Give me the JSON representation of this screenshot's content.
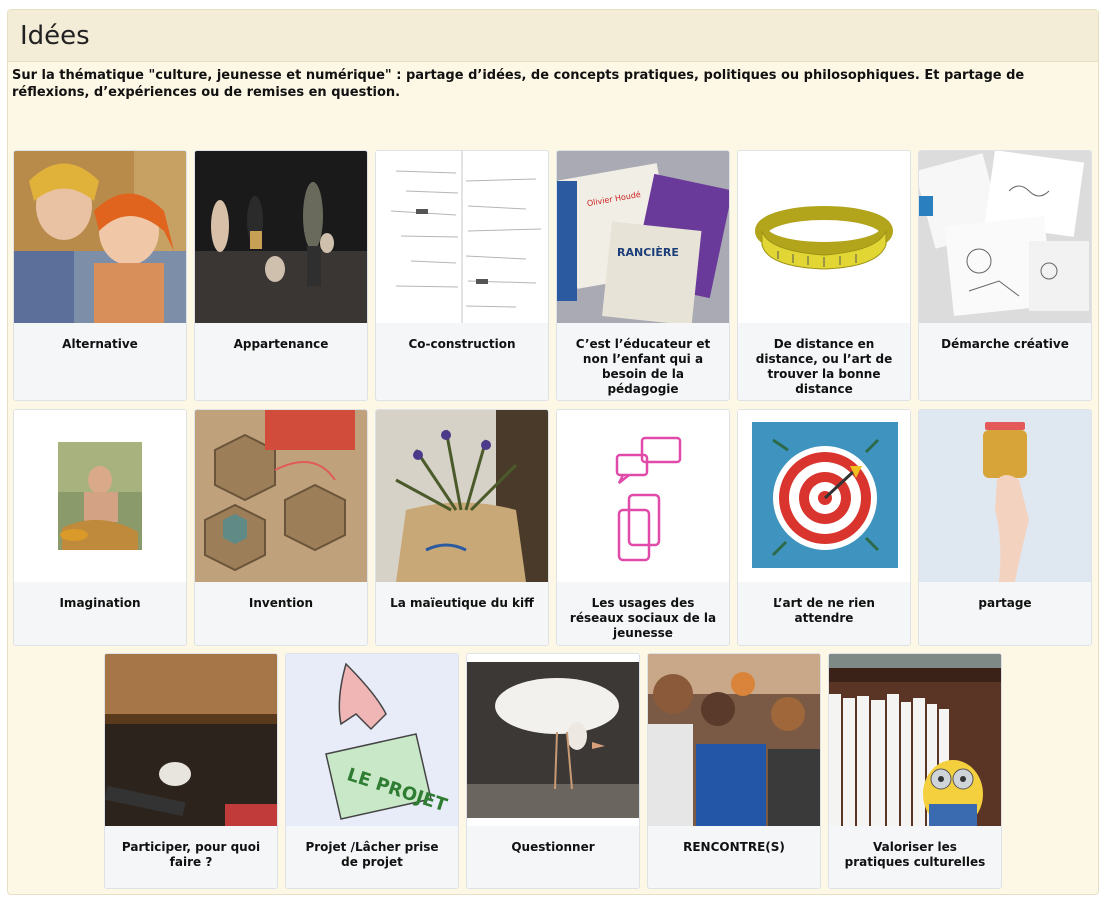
{
  "page": {
    "title": "Idées"
  },
  "intro": "Sur la thématique \"culture, jeunesse et numérique\" : partage d’idées, de concepts pratiques, politiques ou philosophiques. Et partage de réflexions, d’expériences ou de remises en question.",
  "cards": [
    {
      "label": "Alternative",
      "image": "photo-woman-and-girl"
    },
    {
      "label": "Appartenance",
      "image": "photo-stage-performance"
    },
    {
      "label": "Co-construction",
      "image": "mindmap-diagram"
    },
    {
      "label": "C’est l’éducateur et non l’enfant qui a besoin de la pédagogie",
      "image": "photo-books"
    },
    {
      "label": "De distance en distance, ou l’art de trouver la bonne distance",
      "image": "tape-measure"
    },
    {
      "label": "Démarche créative",
      "image": "photo-sketches"
    },
    {
      "label": "Imagination",
      "image": "painting-man-with-fish"
    },
    {
      "label": "Invention",
      "image": "photo-hexagon-kit"
    },
    {
      "label": "La maïeutique du kiff",
      "image": "photo-plant-bag"
    },
    {
      "label": "Les usages des réseaux sociaux de la jeunesse",
      "image": "social-media-icon"
    },
    {
      "label": "L’art de ne rien attendre",
      "image": "target-darts"
    },
    {
      "label": "partage",
      "image": "hand-jar"
    },
    {
      "label": "Participer, pour quoi faire ?",
      "image": "photo-cat-under-table"
    },
    {
      "label": "Projet /Lâcher prise de projet",
      "image": "drawing-hand-project"
    },
    {
      "label": "Questionner",
      "image": "photo-chick"
    },
    {
      "label": "RENCONTRE(S)",
      "image": "photo-kids-group"
    },
    {
      "label": "Valoriser les pratiques culturelles",
      "image": "photo-bookshelf-minion"
    }
  ],
  "colors": {
    "panel_bg": "#fdf8e6",
    "header_bg": "#f3ecd6",
    "card_bg": "#f4f6f7"
  }
}
